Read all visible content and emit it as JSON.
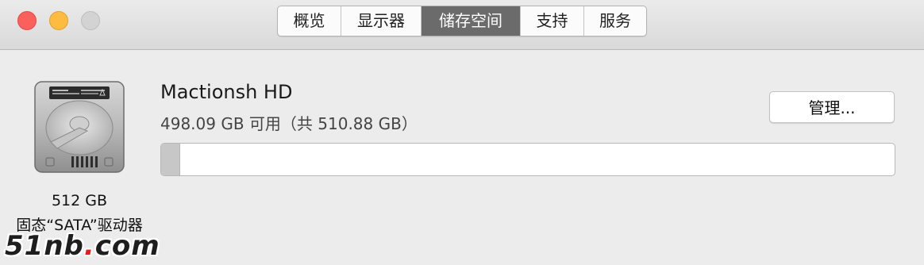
{
  "window": {
    "tabs": [
      {
        "label": "概览",
        "active": false
      },
      {
        "label": "显示器",
        "active": false
      },
      {
        "label": "储存空间",
        "active": true
      },
      {
        "label": "支持",
        "active": false
      },
      {
        "label": "服务",
        "active": false
      }
    ]
  },
  "drive": {
    "icon": "hard-drive-icon",
    "capacity": "512 GB",
    "type": "固态“SATA”驱动器"
  },
  "volume": {
    "name": "Mactionsh HD",
    "availability": "498.09 GB 可用（共 510.88 GB）",
    "used_fraction": 0.025
  },
  "actions": {
    "manage_label": "管理..."
  },
  "watermark": {
    "text_prefix": "51nb",
    "dot": ".",
    "text_suffix": "com"
  },
  "colors": {
    "accent_tab": "#6b6b6b",
    "close": "#fc605c",
    "minimize": "#fdbc40",
    "usage_fill": "#c7c7c7"
  }
}
